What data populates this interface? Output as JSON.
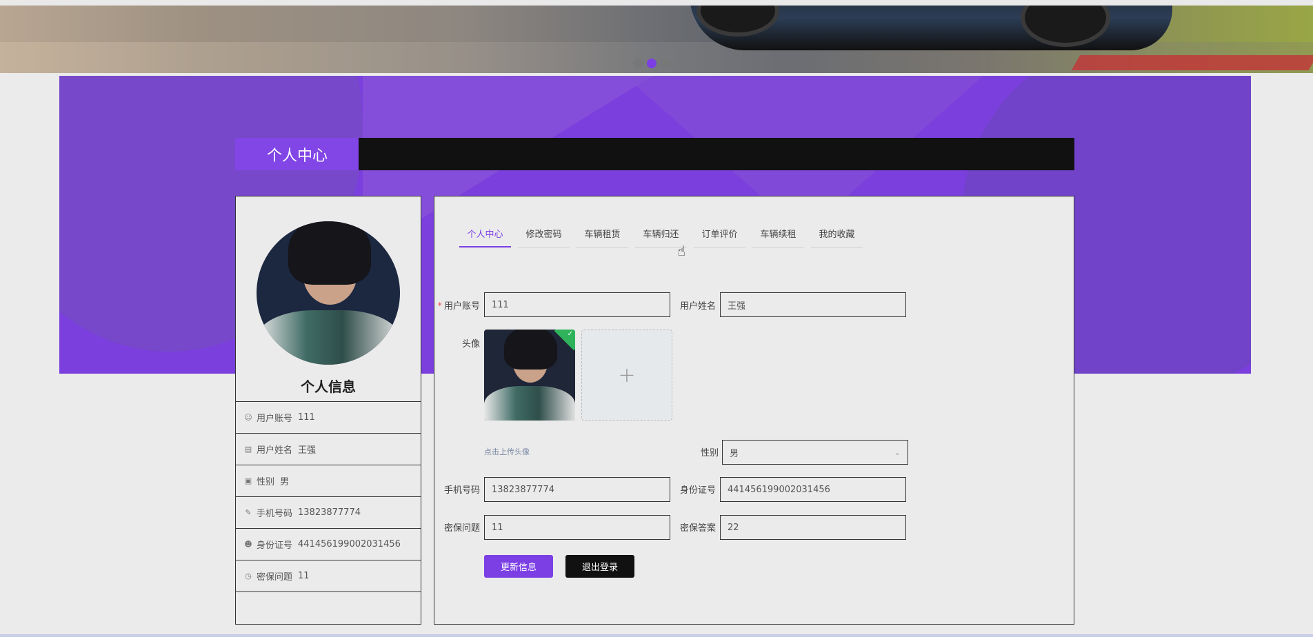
{
  "banner": {
    "slide_count": 3,
    "active_slide": 2,
    "accent_color": "#7b3fe4"
  },
  "section": {
    "title": "个人中心"
  },
  "profile": {
    "title": "个人信息",
    "rows": [
      {
        "icon": "user-icon",
        "label": "用户账号",
        "value": "111"
      },
      {
        "icon": "id-card-icon",
        "label": "用户姓名",
        "value": "王强"
      },
      {
        "icon": "gender-icon",
        "label": "性别",
        "value": "男"
      },
      {
        "icon": "edit-icon",
        "label": "手机号码",
        "value": "13823877774"
      },
      {
        "icon": "person-icon",
        "label": "身份证号",
        "value": "441456199002031456"
      },
      {
        "icon": "clock-icon",
        "label": "密保问题",
        "value": "11"
      }
    ]
  },
  "tabs": [
    {
      "label": "个人中心",
      "active": true
    },
    {
      "label": "修改密码",
      "active": false
    },
    {
      "label": "车辆租赁",
      "active": false
    },
    {
      "label": "车辆归还",
      "active": false
    },
    {
      "label": "订单评价",
      "active": false
    },
    {
      "label": "车辆续租",
      "active": false
    },
    {
      "label": "我的收藏",
      "active": false
    }
  ],
  "form": {
    "account_label": "用户账号",
    "account_value": "111",
    "name_label": "用户姓名",
    "name_value": "王强",
    "avatar_label": "头像",
    "upload_plus": "+",
    "upload_hint": "点击上传头像",
    "gender_label": "性别",
    "gender_value": "男",
    "phone_label": "手机号码",
    "phone_value": "13823877774",
    "idcard_label": "身份证号",
    "idcard_value": "441456199002031456",
    "question_label": "密保问题",
    "question_value": "11",
    "answer_label": "密保答案",
    "answer_value": "22",
    "update_button": "更新信息",
    "logout_button": "退出登录"
  }
}
